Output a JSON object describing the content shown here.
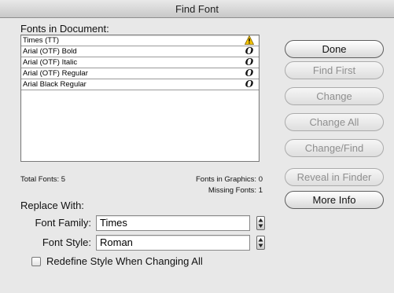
{
  "window": {
    "title": "Find Font"
  },
  "fonts_section": {
    "label": "Fonts in Document:",
    "fonts": [
      {
        "name": "Times (TT)",
        "badge": "warning-icon"
      },
      {
        "name": "Arial (OTF) Bold",
        "badge": "opentype-icon"
      },
      {
        "name": "Arial (OTF) Italic",
        "badge": "opentype-icon"
      },
      {
        "name": "Arial (OTF) Regular",
        "badge": "opentype-icon"
      },
      {
        "name": "Arial Black Regular",
        "badge": "opentype-icon"
      }
    ],
    "total_fonts": "Total Fonts: 5",
    "fonts_in_graphics": "Fonts in Graphics: 0",
    "missing_fonts": "Missing Fonts: 1"
  },
  "replace": {
    "label": "Replace With:",
    "family_label": "Font Family:",
    "family_value": "Times",
    "style_label": "Font Style:",
    "style_value": "Roman",
    "redefine_label": "Redefine Style When Changing All",
    "redefine_checked": false
  },
  "buttons": {
    "done": "Done",
    "find_first": "Find First",
    "change": "Change",
    "change_all": "Change All",
    "change_find": "Change/Find",
    "reveal_in_finder": "Reveal in Finder",
    "more_info": "More Info"
  },
  "colors": {
    "warning": "#f5c400",
    "background": "#e8e8e8",
    "disabled_text": "#8f8f8f"
  }
}
